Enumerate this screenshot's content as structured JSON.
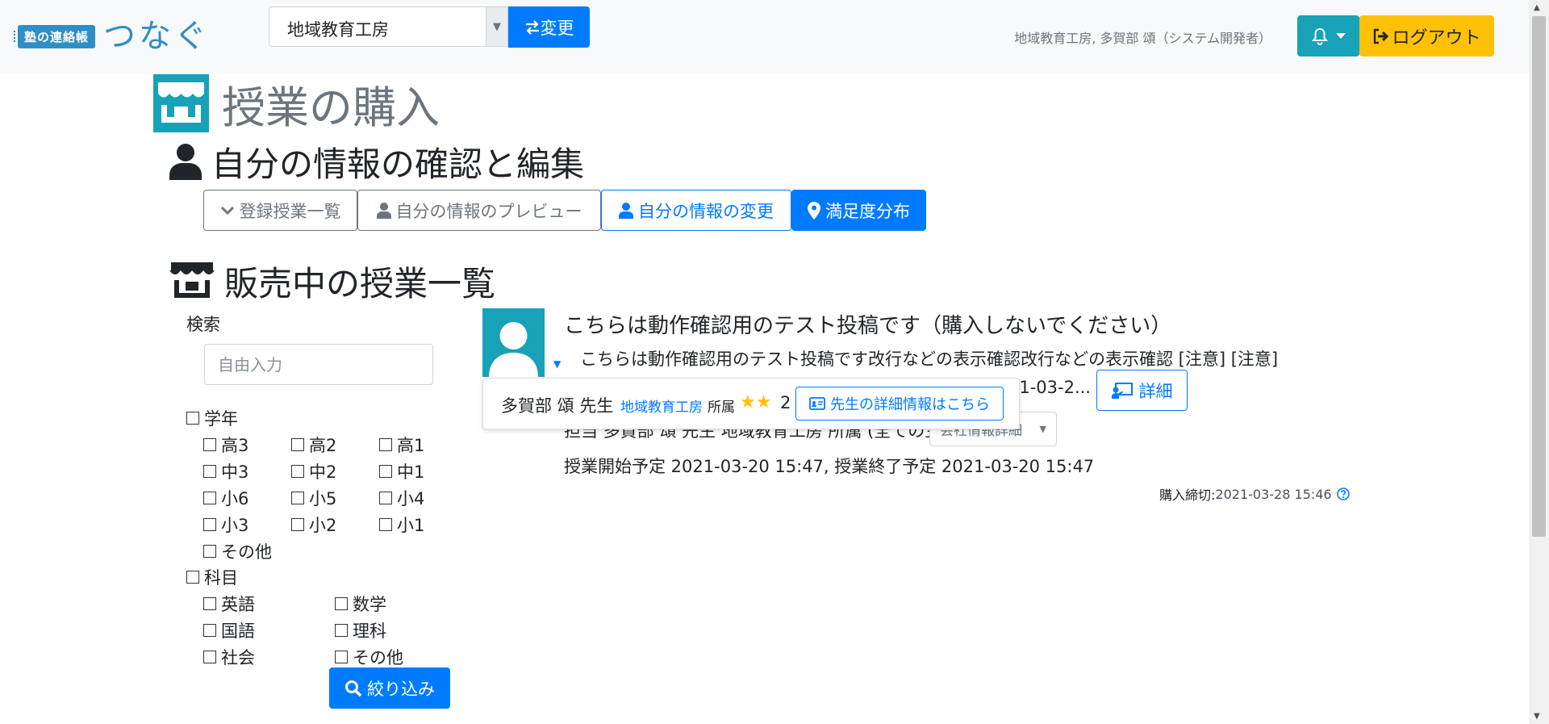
{
  "app": {
    "logo_badge": "塾の連絡帳",
    "logo_name": "つなぐ"
  },
  "navbar": {
    "org_select_value": "地域教育工房",
    "change_label": "変更",
    "user_info": "地域教育工房, 多賀部 頌（システム開発者）",
    "logout_label": "ログアウト"
  },
  "page": {
    "title": "授業の購入",
    "section_profile": "自分の情報の確認と編集",
    "section_listing": "販売中の授業一覧"
  },
  "tabs": {
    "registered": "登録授業一覧",
    "preview": "自分の情報のプレビュー",
    "edit": "自分の情報の変更",
    "satisfaction": "満足度分布"
  },
  "search": {
    "label": "検索",
    "placeholder": "自由入力",
    "grade_label": "学年",
    "grades": [
      "高3",
      "高2",
      "高1",
      "中3",
      "中2",
      "中1",
      "小6",
      "小5",
      "小4",
      "小3",
      "小2",
      "小1",
      "その他"
    ],
    "subject_label": "科目",
    "subjects": [
      "英語",
      "数学",
      "国語",
      "理科",
      "社会",
      "その他"
    ],
    "filter_label": "絞り込み"
  },
  "listing": {
    "title": "こちらは動作確認用のテスト投稿です（購入しないでください）",
    "description": "こちらは動作確認用のテスト投稿です改行などの表示確認改行などの表示確認 [注意] [注意]",
    "date_fragment": "21-03-2...",
    "detail_label": "詳細",
    "teacher_line": "担当 多賀部 頌 先生 地域教育工房 所属 (全ての生徒)",
    "company_select": "会社情報詳細",
    "schedule": "授業開始予定 2021-03-20 15:47, 授業終了予定 2021-03-20 15:47",
    "deadline_label": "購入締切:",
    "deadline_value": "2021-03-28 15:46"
  },
  "popover": {
    "teacher_name": "多賀部 頌 先生",
    "org": "地域教育工房",
    "belong": "所属",
    "stars": "★★",
    "score": "2",
    "teacher_detail_label": "先生の詳細情報はこちら"
  },
  "colors": {
    "primary": "#007bff",
    "info": "#17a2b8",
    "warning": "#ffc107",
    "brand": "#2f8fc4"
  }
}
